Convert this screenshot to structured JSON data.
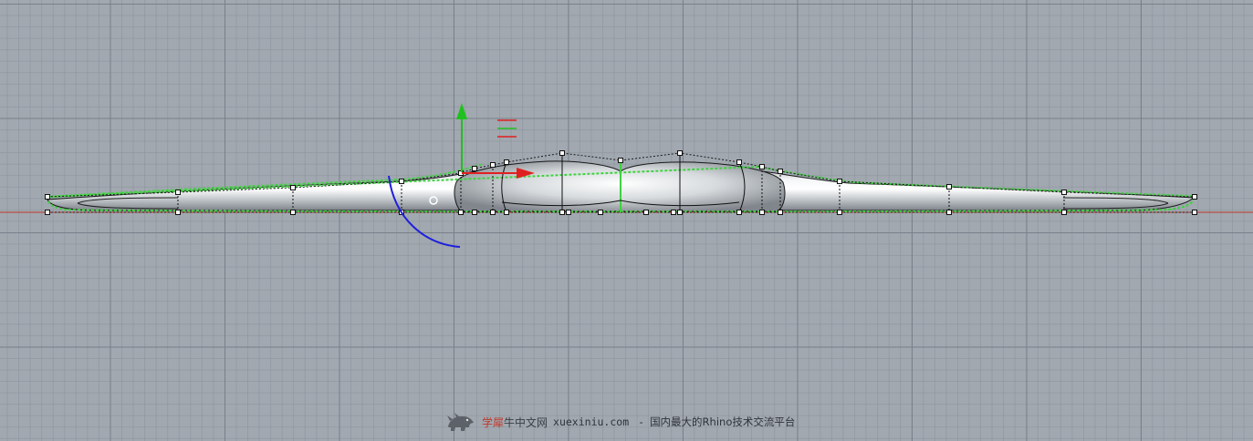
{
  "viewport": {
    "background_color": "#a1a8b0",
    "grid_minor_color": "#8a919a",
    "grid_major_color": "#787f88",
    "x_axis_color": "#c0392b"
  },
  "gumball": {
    "x_arrow_color": "#e02020",
    "y_arrow_color": "#20c020",
    "rotation_arc_color": "#1f1fdc",
    "scale_glyph": "☰"
  },
  "curves": {
    "selected_curve_color": "#3fd23f",
    "control_polygon_color": "#202020"
  },
  "watermark": {
    "brand_prefix": "学犀",
    "brand_suffix": "牛中文网",
    "site": "xuexiniu.com",
    "separator": "-",
    "slogan": "国内最大的Rhino技术交流平台"
  }
}
